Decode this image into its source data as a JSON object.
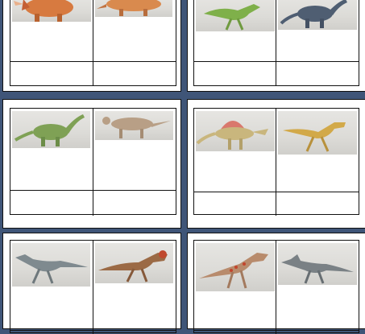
{
  "sheet": {
    "cards": [
      {
        "name": "card-1",
        "images": [
          {
            "icon": "triceratops-drawing-icon",
            "color": "#d77a40"
          },
          {
            "icon": "ankylosaur-drawing-icon",
            "color": "#d98a4e"
          }
        ]
      },
      {
        "name": "card-2",
        "images": [
          {
            "icon": "green-theropod-drawing-icon",
            "color": "#7fb04a"
          },
          {
            "icon": "sauropod-drawing-icon",
            "color": "#4f5e72"
          }
        ]
      },
      {
        "name": "card-3",
        "images": [
          {
            "icon": "green-sauropod-drawing-icon",
            "color": "#7fa155"
          },
          {
            "icon": "spotted-quadruped-drawing-icon",
            "color": "#b89f86"
          }
        ]
      },
      {
        "name": "card-4",
        "images": [
          {
            "icon": "spinosaurus-drawing-icon",
            "color": "#d9786d"
          },
          {
            "icon": "yellow-theropod-drawing-icon",
            "color": "#d2a949"
          }
        ]
      },
      {
        "name": "card-5",
        "images": [
          {
            "icon": "grey-raptor-drawing-icon",
            "color": "#7f8a8f"
          },
          {
            "icon": "brown-theropod-drawing-icon",
            "color": "#9b6a45"
          }
        ]
      },
      {
        "name": "card-6",
        "images": [
          {
            "icon": "spotted-theropod-drawing-icon",
            "color": "#b88b6c"
          },
          {
            "icon": "grey-ornithomimid-drawing-icon",
            "color": "#7a8185"
          }
        ]
      }
    ]
  }
}
